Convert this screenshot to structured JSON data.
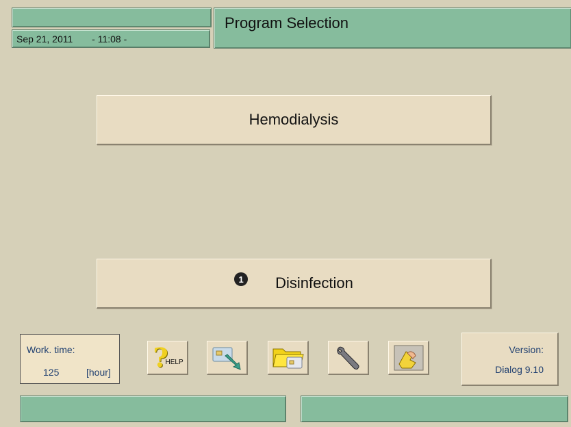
{
  "header": {
    "date": "Sep 21, 2011",
    "time": "- 11:08 -",
    "title": "Program Selection"
  },
  "programs": [
    {
      "label": "Hemodialysis"
    },
    {
      "label": "Disinfection",
      "badge": "1"
    }
  ],
  "work_time": {
    "label": "Work. time:",
    "value": "125",
    "unit": "[hour]"
  },
  "toolbar": {
    "help_text": "HELP",
    "icons": [
      "help-icon",
      "card-eject-icon",
      "folder-card-icon",
      "wrench-icon",
      "cleaning-hand-icon"
    ]
  },
  "version": {
    "label": "Version:",
    "value": "Dialog 9.10"
  },
  "colors": {
    "background": "#d6d0b8",
    "bar_green": "#86bc9d",
    "button_face": "#e8dcc2",
    "info_text": "#1f3f70"
  }
}
